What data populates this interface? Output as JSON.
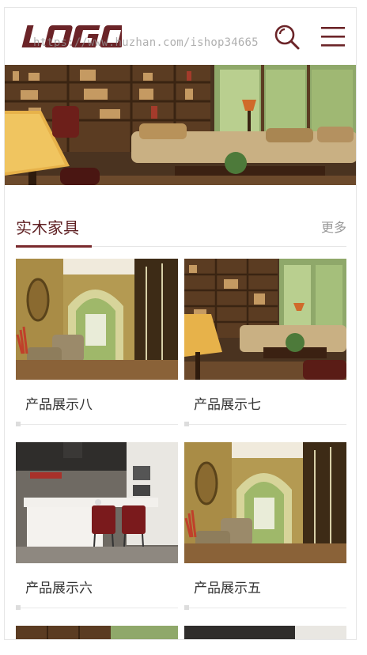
{
  "header": {
    "logo_text": "LOGO",
    "watermark": "https://www.huzhan.com/ishop34665",
    "search_icon": "search-icon",
    "menu_icon": "hamburger-menu-icon"
  },
  "colors": {
    "brand": "#6b2428",
    "underline": "#7a2a2d",
    "muted": "#999999"
  },
  "banner": {
    "image": "living-room-photo"
  },
  "section": {
    "title": "实木家具",
    "more": "更多"
  },
  "products": [
    {
      "name": "产品展示八",
      "image": "arched-hallway-photo"
    },
    {
      "name": "产品展示七",
      "image": "living-room-photo"
    },
    {
      "name": "产品展示六",
      "image": "kitchen-photo"
    },
    {
      "name": "产品展示五",
      "image": "arched-hallway-photo"
    }
  ]
}
